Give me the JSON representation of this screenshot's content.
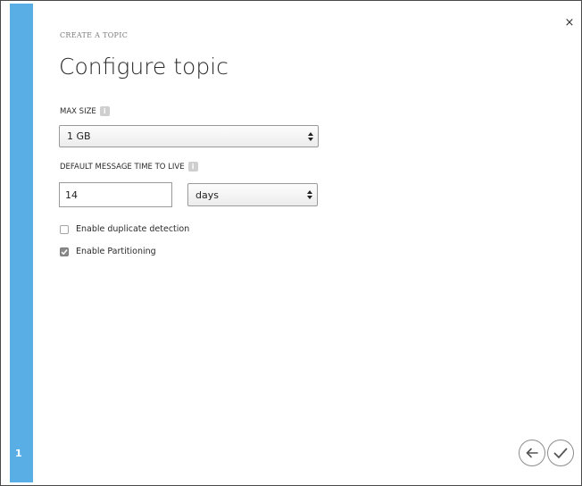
{
  "wizard": {
    "label": "CREATE A TOPIC",
    "title": "Configure topic",
    "step": "1",
    "close_glyph": "×"
  },
  "max_size": {
    "label": "MAX SIZE",
    "value": "1 GB"
  },
  "ttl": {
    "label": "DEFAULT MESSAGE TIME TO LIVE",
    "value": "14",
    "unit": "days"
  },
  "options": {
    "duplicate_detection": {
      "label": "Enable duplicate detection",
      "checked": false
    },
    "partitioning": {
      "label": "Enable Partitioning",
      "checked": true
    }
  },
  "icons": {
    "close": "close-icon",
    "info": "info-icon",
    "back": "back-arrow-icon",
    "complete": "checkmark-icon",
    "select": "select-arrows-icon"
  },
  "colors": {
    "accent_rail": "#5aaee6",
    "checkbox_checked": "#8a8a8a"
  }
}
